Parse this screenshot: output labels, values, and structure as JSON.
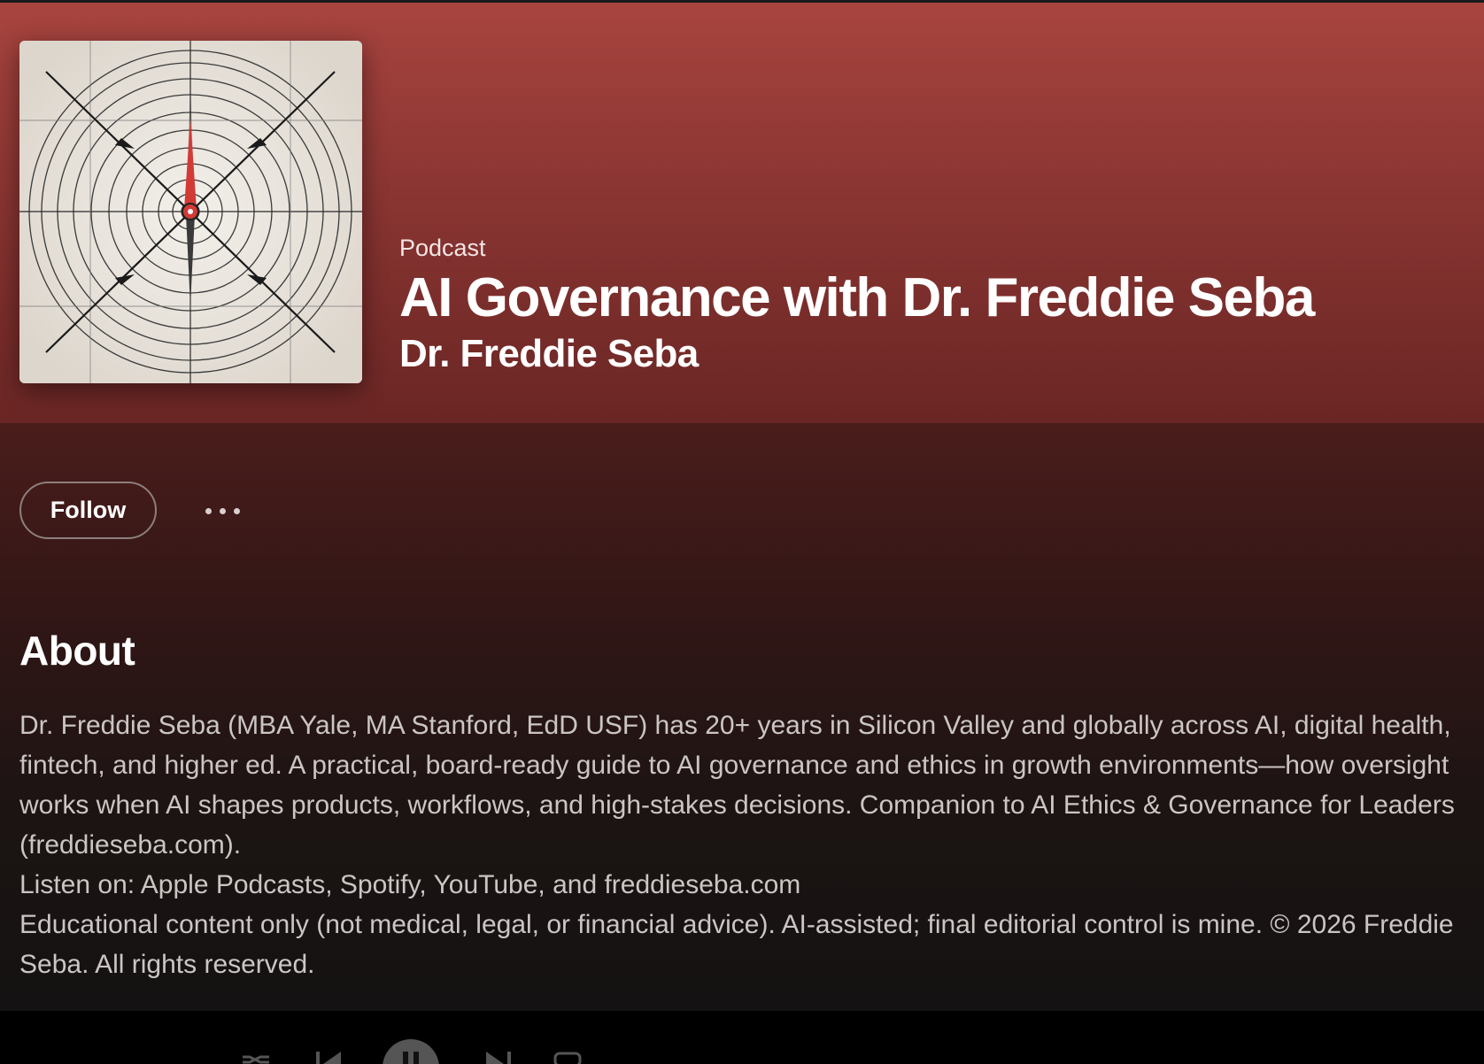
{
  "header": {
    "type_label": "Podcast",
    "title": "AI Governance with Dr. Freddie Seba",
    "author": "Dr. Freddie Seba"
  },
  "cover": {
    "icon": "compass-cover-art",
    "accent": "#d23a36"
  },
  "actions": {
    "follow_label": "Follow",
    "more_icon": "ellipsis-icon"
  },
  "about": {
    "heading": "About",
    "paragraphs": [
      "Dr. Freddie Seba (MBA Yale, MA Stanford, EdD USF) has 20+ years in Silicon Valley and globally across AI, digital health, fintech, and higher ed. A practical, board-ready guide to AI governance and ethics in growth environments—how oversight works when AI shapes products, workflows, and high-stakes decisions. Companion to AI Ethics & Governance for Leaders (freddieseba.com).",
      "Listen on: Apple Podcasts, Spotify, YouTube, and freddieseba.com",
      "Educational content only (not medical, legal, or financial advice). AI-assisted; final editorial control is mine. © 2026 Freddie Seba. All rights reserved."
    ]
  },
  "player": {
    "controls": [
      "shuffle-icon",
      "previous-icon",
      "pause-icon",
      "next-icon",
      "queue-icon"
    ]
  },
  "colors": {
    "hero": "#a8443f",
    "background": "#121212",
    "text_muted": "#cbc5c4"
  }
}
